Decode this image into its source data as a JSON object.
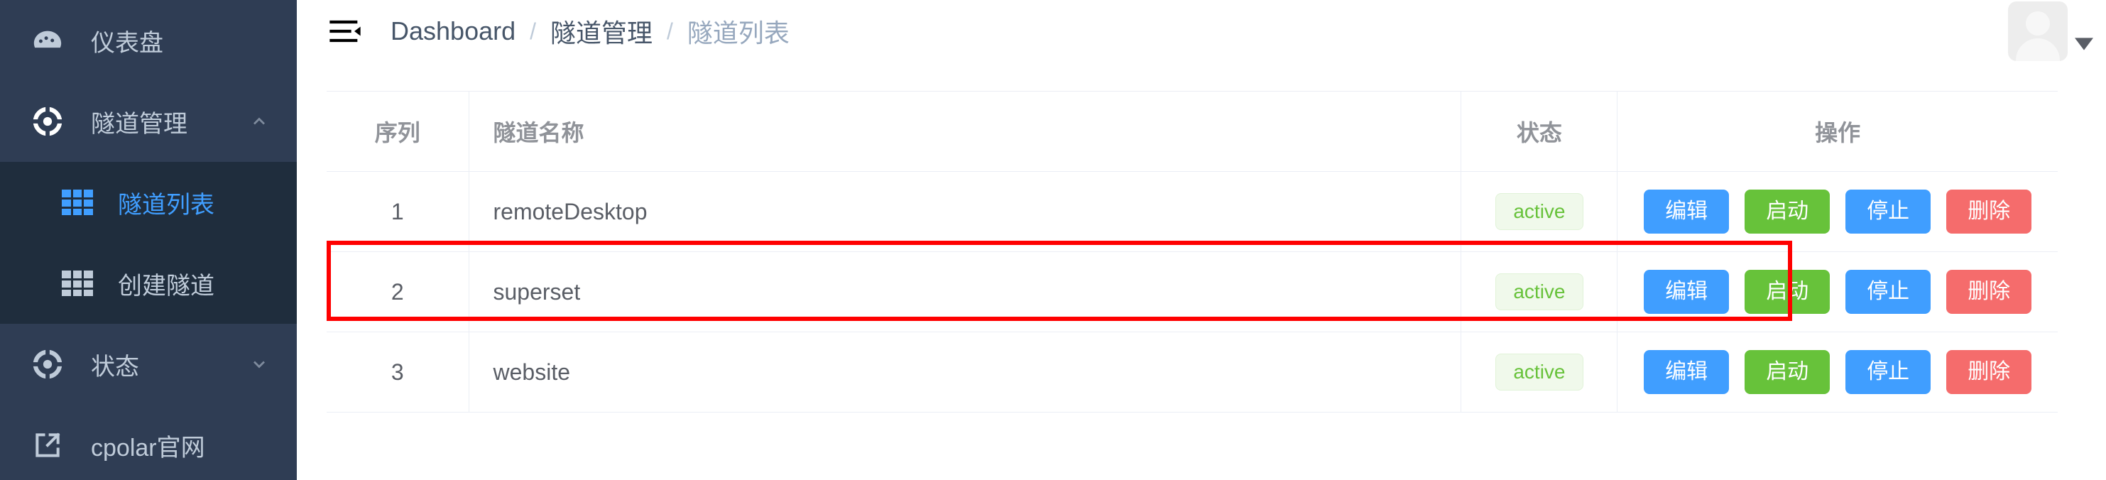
{
  "sidebar": {
    "items": [
      {
        "label": "仪表盘",
        "icon": "dashboard-icon",
        "type": "top",
        "expandable": false,
        "active": false
      },
      {
        "label": "隧道管理",
        "icon": "tunnel-icon",
        "type": "top",
        "expandable": true,
        "expanded": true,
        "chevron": "chevron-up-icon",
        "active": false
      },
      {
        "label": "状态",
        "icon": "status-icon",
        "type": "top",
        "expandable": true,
        "expanded": false,
        "chevron": "chevron-down-icon",
        "active": false
      },
      {
        "label": "cpolar官网",
        "icon": "external-link-icon",
        "type": "top",
        "expandable": false,
        "active": false
      }
    ],
    "submenu": [
      {
        "label": "隧道列表",
        "icon": "grid-icon",
        "active": true
      },
      {
        "label": "创建隧道",
        "icon": "grid-icon",
        "active": false
      }
    ]
  },
  "topbar": {
    "menu_toggle_icon": "hamburger-collapse-icon",
    "breadcrumb": [
      "Dashboard",
      "隧道管理",
      "隧道列表"
    ],
    "breadcrumb_separator": "/",
    "avatar_icon": "user-avatar-icon",
    "avatar_caret_icon": "caret-down-icon"
  },
  "table": {
    "columns": [
      "序列",
      "隧道名称",
      "状态",
      "操作"
    ],
    "rows": [
      {
        "seq": "1",
        "name": "remoteDesktop",
        "status": "active",
        "actions": [
          "编辑",
          "启动",
          "停止",
          "删除"
        ]
      },
      {
        "seq": "2",
        "name": "superset",
        "status": "active",
        "actions": [
          "编辑",
          "启动",
          "停止",
          "删除"
        ]
      },
      {
        "seq": "3",
        "name": "website",
        "status": "active",
        "actions": [
          "编辑",
          "启动",
          "停止",
          "删除"
        ]
      }
    ]
  },
  "colors": {
    "sidebar_bg": "#2f3d54",
    "submenu_bg": "#1f2d3d",
    "accent_blue": "#409eff",
    "success_green": "#67c23a",
    "danger_red": "#f56c6c",
    "badge_bg": "#f0f9eb",
    "annotation_red": "#ff0000"
  }
}
